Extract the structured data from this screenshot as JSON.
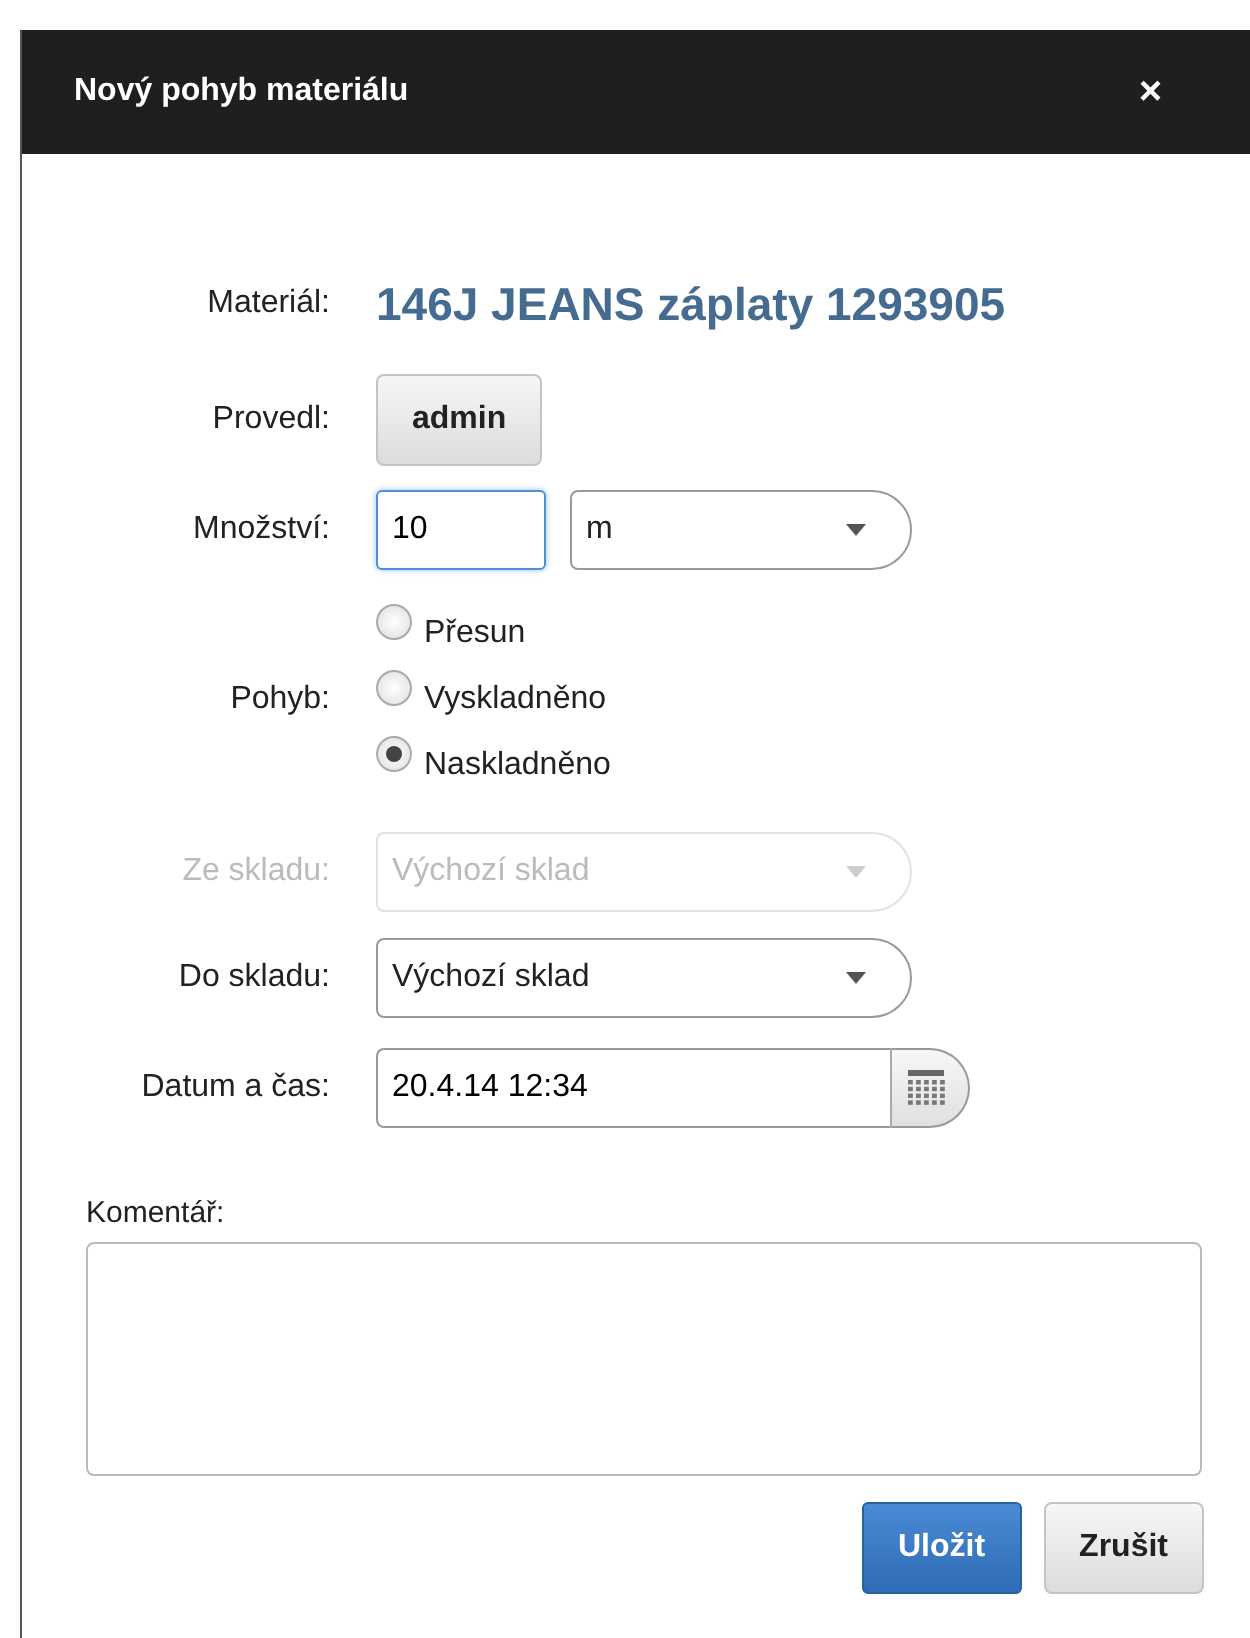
{
  "dialog": {
    "title": "Nový pohyb materiálu",
    "close": "×"
  },
  "fields": [
    {
      "kind": "text",
      "label": "Materiál:",
      "value": "146J JEANS záplaty 1293905"
    },
    {
      "kind": "button",
      "label": "Provedl:",
      "value": "admin"
    },
    {
      "kind": "quantity",
      "label": "Množství:",
      "value": "10",
      "unit": "m",
      "focused": true
    },
    {
      "kind": "radio",
      "label": "Pohyb:",
      "options": [
        {
          "label": "Přesun",
          "selected": false
        },
        {
          "label": "Vyskladněno",
          "selected": false
        },
        {
          "label": "Naskladněno",
          "selected": true
        }
      ]
    },
    {
      "kind": "select",
      "label": "Ze skladu:",
      "value": "Výchozí sklad",
      "disabled": true
    },
    {
      "kind": "select",
      "label": "Do skladu:",
      "value": "Výchozí sklad",
      "disabled": false
    },
    {
      "kind": "date",
      "label": "Datum a čas:",
      "value": "20.4.14 12:34"
    }
  ],
  "comment": {
    "label": "Komentář:"
  },
  "buttons": [
    {
      "label": "Uložit",
      "primary": true
    },
    {
      "label": "Zrušit",
      "primary": false
    }
  ]
}
